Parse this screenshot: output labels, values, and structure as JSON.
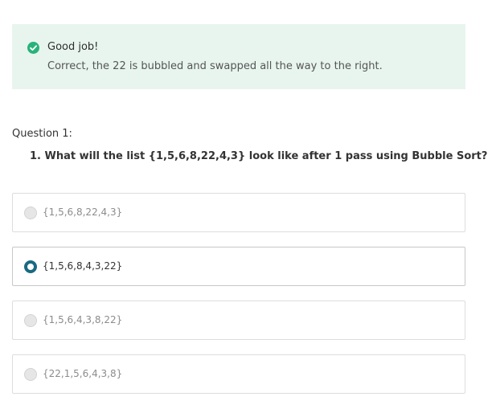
{
  "feedback": {
    "status_icon": "check-circle-icon",
    "status_color": "#2ab27b",
    "title": "Good job!",
    "message": "Correct, the 22 is bubbled and swapped all the way to the right."
  },
  "question": {
    "header": "Question 1:",
    "prefix": "1. What will the list {1,5,6,8,22,4,3} look like after ",
    "emphasis": "1 pass",
    "suffix": " using Bubble Sort?"
  },
  "options": [
    {
      "label": "{1,5,6,8,22,4,3}",
      "selected": false
    },
    {
      "label": "{1,5,6,8,4,3,22}",
      "selected": true
    },
    {
      "label": "{1,5,6,4,3,8,22}",
      "selected": false
    },
    {
      "label": "{22,1,5,6,4,3,8}",
      "selected": false
    }
  ],
  "accent_color": "#186a82"
}
